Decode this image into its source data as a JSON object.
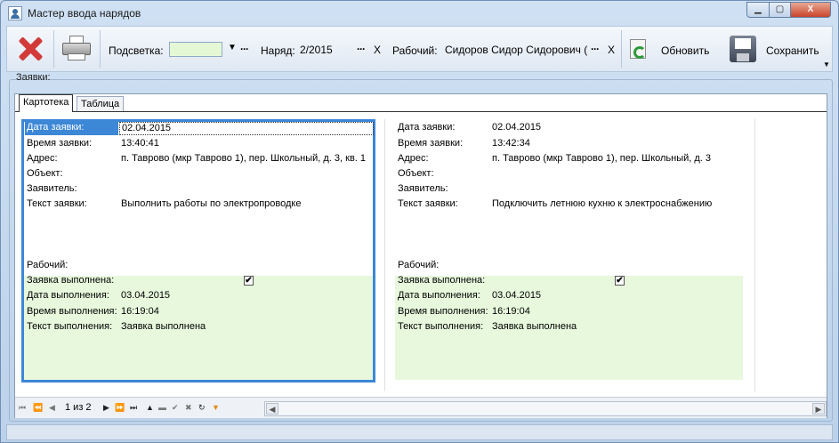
{
  "window": {
    "title": "Мастер ввода нарядов",
    "minimize": "▁",
    "maximize": "▢",
    "close": "X"
  },
  "toolbar": {
    "highlight_label": "Подсветка:",
    "highlight_color": "#e5f8d6",
    "order_label": "Наряд:",
    "order_value": "2/2015",
    "worker_label": "Рабочий:",
    "worker_value": "Сидоров Сидор Сидорович (",
    "dots": "···",
    "clear": "X",
    "dropdown": "▼",
    "refresh_label": "Обновить",
    "save_label": "Сохранить",
    "overflow": "▼"
  },
  "group": {
    "label": "Заявки:"
  },
  "tabs": [
    {
      "label": "Картотека"
    },
    {
      "label": "Таблица"
    }
  ],
  "labels": {
    "request_date": "Дата заявки:",
    "request_time": "Время заявки:",
    "address": "Адрес:",
    "object": "Объект:",
    "applicant": "Заявитель:",
    "request_text": "Текст заявки:",
    "worker": "Рабочий:",
    "completed": "Заявка выполнена:",
    "completion_date": "Дата выполнения:",
    "completion_time": "Время выполнения:",
    "completion_text": "Текст выполнения:"
  },
  "cards": [
    {
      "date": "02.04.2015",
      "time": "13:40:41",
      "address": "п. Таврово (мкр Таврово 1), пер. Школьный, д. 3, кв. 1",
      "request_text": "Выполнить работы по электропроводке",
      "completed_mark": "✔",
      "completion_date": "03.04.2015",
      "completion_time": "16:19:04",
      "completion_text": "Заявка выполнена"
    },
    {
      "date": "02.04.2015",
      "time": "13:42:34",
      "address": "п. Таврово (мкр Таврово 1), пер. Школьный, д. 3",
      "request_text": "Подключить летнюю кухню к электроснабжению",
      "completed_mark": "✔",
      "completion_date": "03.04.2015",
      "completion_time": "16:19:04",
      "completion_text": "Заявка выполнена"
    }
  ],
  "navigator": {
    "position": "1 из 2",
    "first": "⏮",
    "prev_page": "⏪",
    "prev": "◀",
    "next": "▶",
    "next_page": "⏩",
    "last": "⏭",
    "insert": "▲",
    "delete": "▬",
    "post": "✔",
    "cancel": "✖",
    "refresh": "↻",
    "filter": "▼",
    "scroll_left": "◀",
    "scroll_right": "▶"
  }
}
